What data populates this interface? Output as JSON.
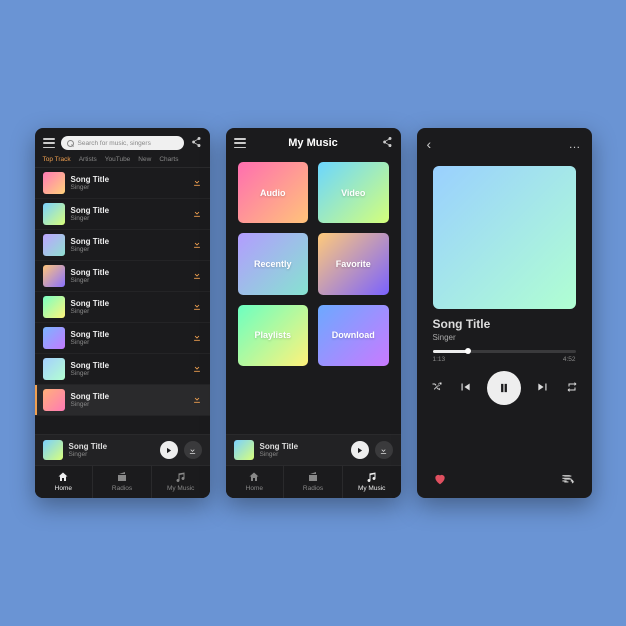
{
  "screen1": {
    "search_placeholder": "Search for music, singers",
    "tabs": [
      "Top Track",
      "Artists",
      "YouTube",
      "New",
      "Charts"
    ],
    "active_tab": 0,
    "songs": [
      {
        "title": "Song Title",
        "artist": "Singer",
        "grad": "g1"
      },
      {
        "title": "Song Title",
        "artist": "Singer",
        "grad": "g2"
      },
      {
        "title": "Song Title",
        "artist": "Singer",
        "grad": "g3"
      },
      {
        "title": "Song Title",
        "artist": "Singer",
        "grad": "g4"
      },
      {
        "title": "Song Title",
        "artist": "Singer",
        "grad": "g5"
      },
      {
        "title": "Song Title",
        "artist": "Singer",
        "grad": "g6"
      },
      {
        "title": "Song Title",
        "artist": "Singer",
        "grad": "g7"
      },
      {
        "title": "Song Title",
        "artist": "Singer",
        "grad": "g8"
      }
    ],
    "miniplayer": {
      "title": "Song Title",
      "artist": "Singer",
      "grad": "g2"
    },
    "nav": [
      {
        "key": "home",
        "label": "Home"
      },
      {
        "key": "radios",
        "label": "Radios"
      },
      {
        "key": "mymusic",
        "label": "My Music"
      }
    ],
    "active_nav": "home"
  },
  "screen2": {
    "title": "My Music",
    "categories": [
      {
        "label": "Audio",
        "grad": "cg1"
      },
      {
        "label": "Video",
        "grad": "cg2"
      },
      {
        "label": "Recently",
        "grad": "cg3"
      },
      {
        "label": "Favorite",
        "grad": "cg4"
      },
      {
        "label": "Playlists",
        "grad": "cg5"
      },
      {
        "label": "Download",
        "grad": "cg6"
      }
    ],
    "miniplayer": {
      "title": "Song Title",
      "artist": "Singer",
      "grad": "g2"
    },
    "nav": [
      {
        "key": "home",
        "label": "Home"
      },
      {
        "key": "radios",
        "label": "Radios"
      },
      {
        "key": "mymusic",
        "label": "My Music"
      }
    ],
    "active_nav": "mymusic"
  },
  "screen3": {
    "title": "Song Title",
    "artist": "Singer",
    "elapsed": "1:13",
    "total": "4:52",
    "progress_pct": 25,
    "liked": true
  }
}
